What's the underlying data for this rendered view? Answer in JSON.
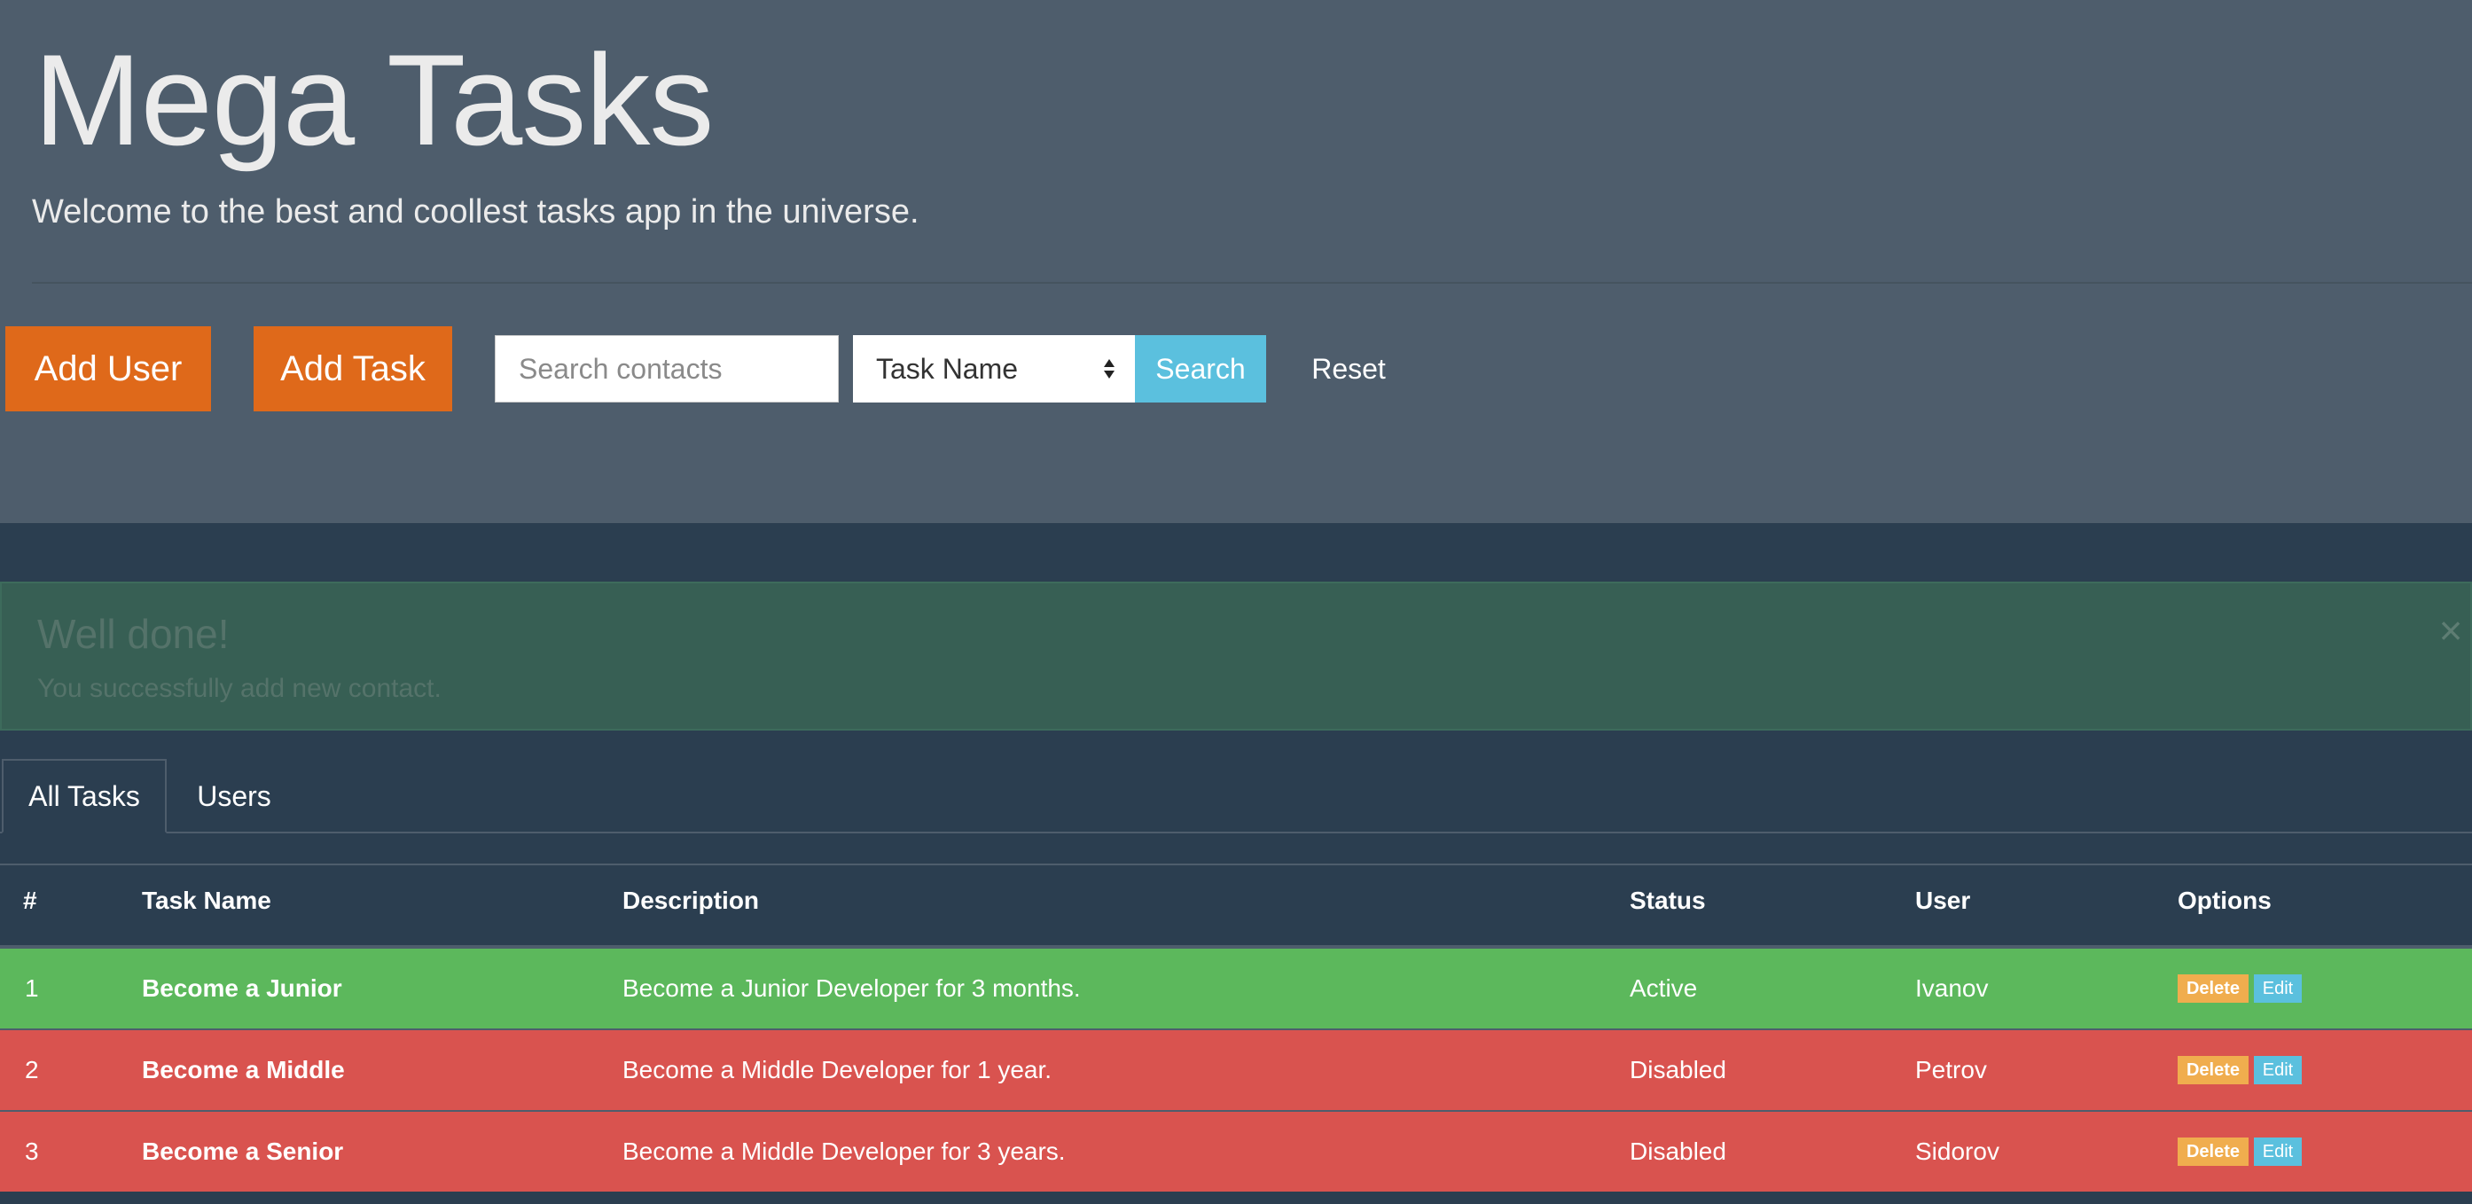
{
  "header": {
    "title": "Mega Tasks",
    "subtitle": "Welcome to the best and coollest tasks app in the universe."
  },
  "toolbar": {
    "add_user_label": "Add User",
    "add_task_label": "Add Task",
    "search_placeholder": "Search contacts",
    "search_value": "",
    "filter_selected": "Task Name",
    "search_label": "Search",
    "reset_label": "Reset"
  },
  "alert": {
    "title": "Well done!",
    "message": "You successfully add new contact.",
    "close_symbol": "×"
  },
  "tabs": [
    {
      "label": "All Tasks",
      "active": true
    },
    {
      "label": "Users",
      "active": false
    }
  ],
  "table": {
    "headers": [
      "#",
      "Task Name",
      "Description",
      "Status",
      "User",
      "Options"
    ],
    "rows": [
      {
        "num": "1",
        "task": "Become a Junior",
        "description": "Become a Junior Developer for 3 months.",
        "status": "Active",
        "user": "Ivanov",
        "delete_label": "Delete",
        "edit_label": "Edit",
        "variant": "success"
      },
      {
        "num": "2",
        "task": "Become a Middle",
        "description": "Become a Middle Developer for 1 year.",
        "status": "Disabled",
        "user": "Petrov",
        "delete_label": "Delete",
        "edit_label": "Edit",
        "variant": "danger"
      },
      {
        "num": "3",
        "task": "Become a Senior",
        "description": "Become a Middle Developer for 3 years.",
        "status": "Disabled",
        "user": "Sidorov",
        "delete_label": "Delete",
        "edit_label": "Edit",
        "variant": "danger"
      }
    ]
  },
  "colors": {
    "jumbotron_bg": "#4e5d6c",
    "page_bg": "#2b3e50",
    "primary_orange": "#df691a",
    "info_blue": "#5bc0de",
    "success_green": "#5cb85c",
    "danger_red": "#d9534f",
    "warning_orange": "#f0ad4e"
  }
}
